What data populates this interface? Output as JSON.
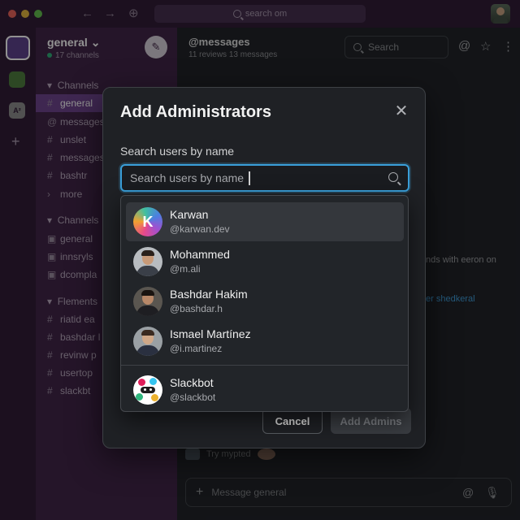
{
  "topbar": {
    "search_text": "search om",
    "back_icon": "arrow-left-icon",
    "forward_icon": "arrow-right-icon",
    "history_icon": "clock-icon"
  },
  "rail": {
    "ws3_label": "A²"
  },
  "sidebar": {
    "workspace_name": "general ⌄",
    "workspace_sub": "17 channels",
    "sections": [
      {
        "label": "Channels"
      },
      {
        "label": "Channels"
      },
      {
        "label": "Flements"
      }
    ],
    "items": [
      {
        "prefix": "#",
        "label": "general"
      },
      {
        "prefix": "@",
        "label": "messages"
      },
      {
        "prefix": "#",
        "label": "unslet"
      },
      {
        "prefix": "#",
        "label": "messages"
      },
      {
        "prefix": "#",
        "label": "bashtr"
      },
      {
        "prefix": "›",
        "label": "more"
      },
      {
        "prefix": "▣",
        "label": "general"
      },
      {
        "prefix": "▣",
        "label": "innsryls"
      },
      {
        "prefix": "▣",
        "label": "dcompla"
      },
      {
        "prefix": "#",
        "label": "riatid ea"
      },
      {
        "prefix": "#",
        "label": "bashdar l"
      },
      {
        "prefix": "#",
        "label": "revinw p"
      },
      {
        "prefix": "#",
        "label": "usertop"
      },
      {
        "prefix": "#",
        "label": "slackbt"
      }
    ]
  },
  "main": {
    "channel_title": "@messages",
    "channel_sub": "11 reviews   13 messages",
    "search_placeholder": "Search",
    "bg_line_1": "nds with eeron on",
    "bg_line_2": "er shedkeral",
    "try_text": "Try mypted",
    "composer_placeholder": "Message general"
  },
  "modal": {
    "title": "Add Administrators",
    "field_label": "Search users by name",
    "search_placeholder": "Search users by name",
    "cancel_label": "Cancel",
    "add_label": "Add Admins"
  },
  "dropdown": {
    "options": [
      {
        "name": "Karwan",
        "handle": "@karwan.dev",
        "avatar": "K",
        "highlighted": true
      },
      {
        "name": "Mohammed",
        "handle": "@m.ali"
      },
      {
        "name": "Bashdar Hakim",
        "handle": "@bashdar.h"
      },
      {
        "name": "Ismael Martínez",
        "handle": "@i.martinez"
      },
      {
        "name": "Slackbot",
        "handle": "@slackbot"
      }
    ]
  },
  "colors": {
    "accent": "#3a9fd9",
    "sidebar_bg": "#3b1e42",
    "active_item": "#6a3f8a",
    "online": "#2bac76"
  }
}
